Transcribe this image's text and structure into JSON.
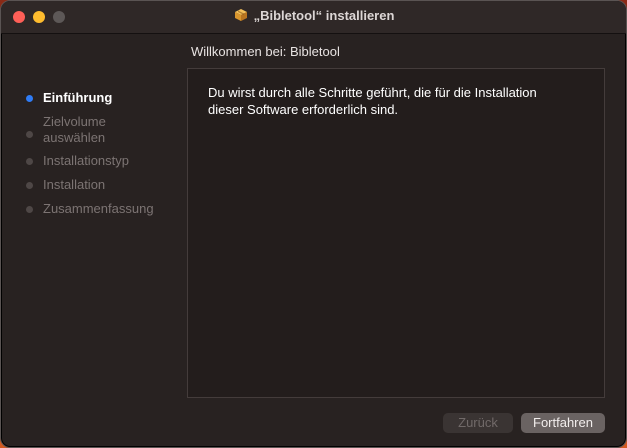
{
  "window": {
    "title": "„Bibletool“ installieren",
    "title_icon": "package-icon"
  },
  "heading": "Willkommen bei: Bibletool",
  "steps": [
    {
      "line1": "Einführung",
      "line2": "",
      "state": "current"
    },
    {
      "line1": "Zielvolume",
      "line2": "auswählen",
      "state": "pending"
    },
    {
      "line1": "Installationstyp",
      "line2": "",
      "state": "pending"
    },
    {
      "line1": "Installation",
      "line2": "",
      "state": "pending"
    },
    {
      "line1": "Zusammenfassung",
      "line2": "",
      "state": "pending"
    }
  ],
  "content": {
    "line1": "Du wirst durch alle Schritte geführt, die für die Installation",
    "line2": "dieser Software erforderlich sind."
  },
  "buttons": {
    "back": "Zurück",
    "continue": "Fortfahren"
  },
  "colors": {
    "accent": "#2f7cf6",
    "close": "#fe5f57",
    "minimize": "#febc2e"
  }
}
